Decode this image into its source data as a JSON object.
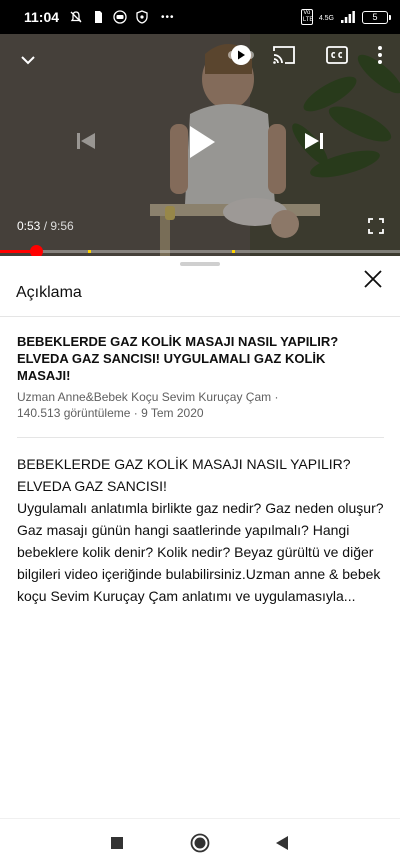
{
  "status_bar": {
    "time": "11:04",
    "icons": [
      "notifications-off-icon",
      "sim-icon",
      "youtube-notification-icon",
      "privacy-icon"
    ],
    "more_glyph": "•••",
    "network_badge": "4.5G",
    "volte_label": "Vo LTE",
    "battery_level": "5"
  },
  "video_player": {
    "current_time": "0:53",
    "separator": " / ",
    "duration": "9:56",
    "progress_fraction": 0.089,
    "colors": {
      "progress": "#ff0000",
      "chapter_marker": "#ffd400"
    }
  },
  "description_panel": {
    "title": "Açıklama",
    "video_title": "BEBEKLERDE GAZ KOLİK MASAJI NASIL YAPILIR? ELVEDA GAZ SANCISI! UYGULAMALI GAZ KOLİK MASAJI!",
    "channel": "Uzman Anne&Bebek Koçu Sevim Kuruçay Çam ·",
    "stats": "140.513 görüntüleme · 9 Tem 2020",
    "body": "BEBEKLERDE GAZ KOLİK MASAJI NASIL YAPILIR?\nELVEDA GAZ SANCISI!\nUygulamalı anlatımla birlikte gaz nedir? Gaz neden oluşur? Gaz masajı günün hangi saatlerinde yapılmalı? Hangi bebeklere kolik denir? Kolik nedir? Beyaz gürültü ve diğer bilgileri video içeriğinde bulabilirsiniz.Uzman anne & bebek koçu Sevim Kuruçay Çam anlatımı ve uygulamasıyla..."
  },
  "nav_bar": {
    "buttons": [
      "recents-square-icon",
      "home-circle-icon",
      "back-triangle-icon"
    ]
  }
}
